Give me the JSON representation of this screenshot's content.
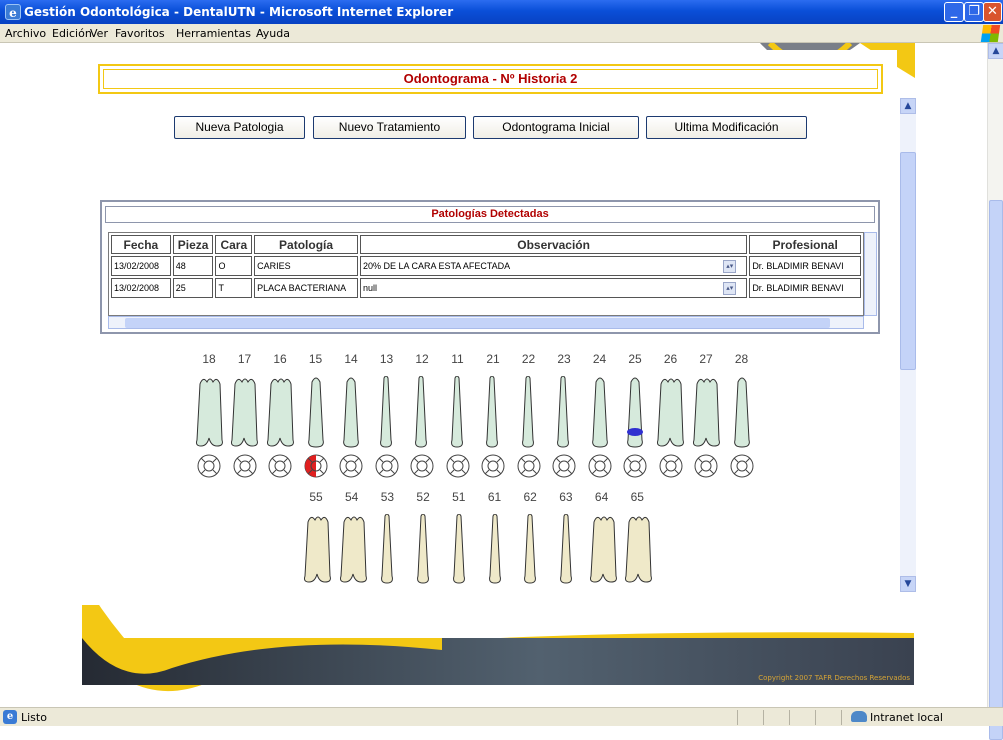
{
  "window": {
    "title": "Gestión Odontológica - DentalUTN - Microsoft Internet Explorer",
    "btn_min": "_",
    "btn_max": "❐",
    "btn_close": "✕"
  },
  "menu": [
    "Archivo",
    "Edición",
    "Ver",
    "Favoritos",
    "Herramientas",
    "Ayuda"
  ],
  "page": {
    "title": "Odontograma - Nº Historia 2"
  },
  "buttons": [
    "Nueva Patologia",
    "Nuevo Tratamiento",
    "Odontograma Inicial",
    "Ultima Modificación"
  ],
  "patologias": {
    "title": "Patologías Detectadas",
    "headers": [
      "Fecha",
      "Pieza",
      "Cara",
      "Patología",
      "Observación",
      "Profesional"
    ],
    "rows": [
      {
        "fecha": "13/02/2008",
        "pieza": "48",
        "cara": "O",
        "patologia": "CARIES",
        "obs": "20% DE LA CARA ESTA AFECTADA",
        "prof": "Dr. BLADIMIR BENAVI"
      },
      {
        "fecha": "13/02/2008",
        "pieza": "25",
        "cara": "T",
        "patologia": "PLACA BACTERIANA",
        "obs": "null",
        "prof": "Dr. BLADIMIR BENAVI"
      }
    ]
  },
  "upper_teeth": [
    "18",
    "17",
    "16",
    "15",
    "14",
    "13",
    "12",
    "11",
    "21",
    "22",
    "23",
    "24",
    "25",
    "26",
    "27",
    "28"
  ],
  "lower_teeth": [
    "55",
    "54",
    "53",
    "52",
    "51",
    "61",
    "62",
    "63",
    "64",
    "65"
  ],
  "footer": {
    "copyright": "Copyright 2007 TAFR Derechos Reservados"
  },
  "status": {
    "text": "Listo",
    "zone": "Intranet local"
  },
  "colors": {
    "accent_yellow": "#f3c814",
    "title_red": "#b10000",
    "tooth_green": "#d6eadc",
    "tooth_cream": "#efe9c9",
    "marker_red": "#e02020",
    "marker_blue": "#3030d0"
  }
}
